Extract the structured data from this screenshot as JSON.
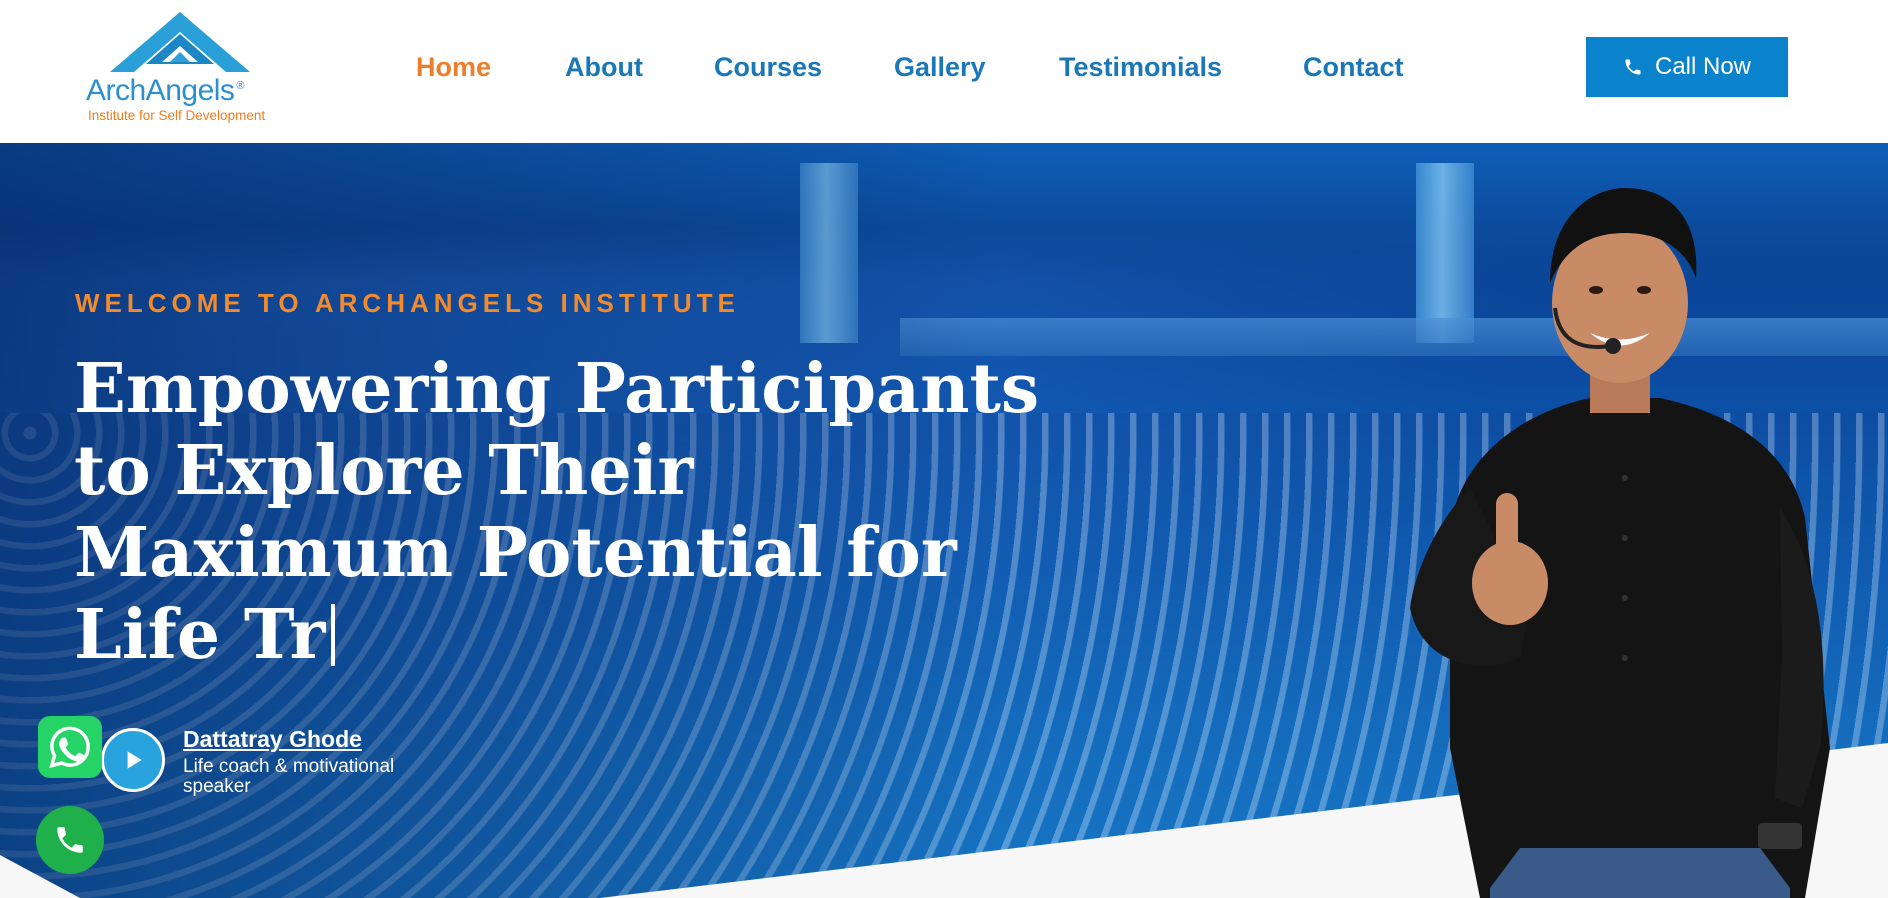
{
  "brand": {
    "name": "ArchAngels",
    "registered_mark": "®",
    "tagline": "Institute for Self Development",
    "colors": {
      "primary_blue": "#1b78b8",
      "accent_orange": "#ef7e2a",
      "button_blue": "#0a82cc",
      "whatsapp_green": "#25d366"
    }
  },
  "nav": {
    "items": [
      {
        "label": "Home",
        "active": true
      },
      {
        "label": "About",
        "active": false
      },
      {
        "label": "Courses",
        "active": false
      },
      {
        "label": "Gallery",
        "active": false
      },
      {
        "label": "Testimonials",
        "active": false
      },
      {
        "label": "Contact",
        "active": false
      }
    ],
    "call_button": {
      "label": "Call Now",
      "icon": "phone-icon"
    }
  },
  "hero": {
    "eyebrow": "WELCOME TO ARCHANGELS INSTITUTE",
    "headline_lines": [
      "Empowering Participants",
      "to Explore Their",
      "Maximum Potential for",
      "Life Tr"
    ],
    "speaker": {
      "name": "Dattatray Ghode",
      "role": "Life coach & motivational speaker",
      "play_icon": "play-icon"
    }
  },
  "floating": {
    "whatsapp_icon": "whatsapp-icon",
    "phone_icon": "phone-icon"
  }
}
